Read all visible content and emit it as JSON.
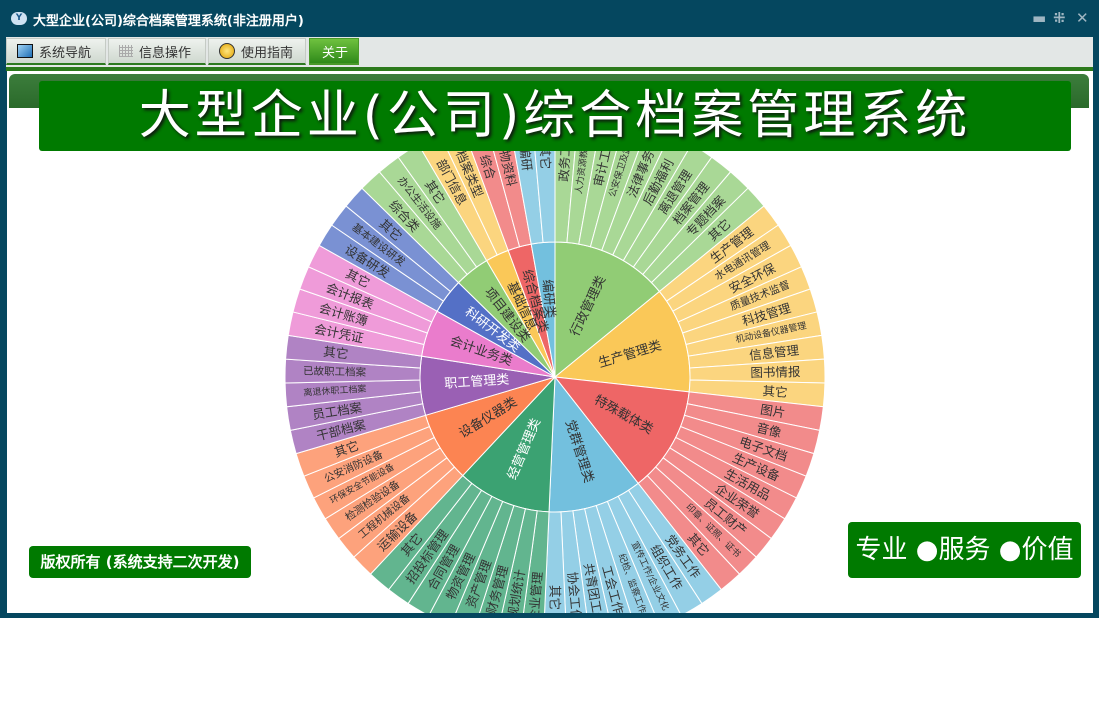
{
  "window": {
    "title": "大型企业(公司)综合档案管理系统(非注册用户)",
    "controls": {
      "minimize": "▬",
      "restore": "⁜",
      "close": "✕"
    }
  },
  "tabs": [
    {
      "label": "系统导航",
      "icon": "monitor-icon"
    },
    {
      "label": "信息操作",
      "icon": "grid-icon"
    },
    {
      "label": "使用指南",
      "icon": "help-icon"
    },
    {
      "label": "关于",
      "active": true
    }
  ],
  "banner": {
    "title": "大型企业(公司)综合档案管理系统"
  },
  "footer": {
    "copyright": "版权所有 (系统支持二次开发)",
    "slogan": "专业 ●服务 ●价值"
  },
  "chart_data": {
    "type": "sunburst",
    "categories": [
      {
        "name": "行政管理类",
        "color": "#91cc75",
        "leafColor": "#a9d896",
        "children": [
          "政务工作",
          "人力资源教育培训",
          "审计工作",
          "公安保卫及武装",
          "法律事务",
          "后勤福利",
          "离退管理",
          "档案管理",
          "专题档案",
          "其它"
        ]
      },
      {
        "name": "生产管理类",
        "color": "#fac858",
        "leafColor": "#fbd57f",
        "children": [
          "生产管理",
          "水电通讯管理",
          "安全环保",
          "质量技术监督",
          "科技管理",
          "机动设备仪器管理",
          "信息管理",
          "图书情报",
          "其它"
        ]
      },
      {
        "name": "特殊载体类",
        "color": "#ee6666",
        "leafColor": "#f28b8b",
        "children": [
          "图片",
          "音像",
          "电子文档",
          "生产设备",
          "生活用品",
          "企业荣誉",
          "员工财产",
          "印章、证照、证书",
          "其它"
        ]
      },
      {
        "name": "党群管理类",
        "color": "#73c0de",
        "leafColor": "#94cfe6",
        "children": [
          "党务工作",
          "组织工作",
          "宣传工作/企业文化",
          "纪检、监察工作",
          "工会工作",
          "共青团工作",
          "协会工作",
          "其它"
        ]
      },
      {
        "name": "经营管理类",
        "color": "#3ba272",
        "leafColor": "#62b58f",
        "children": [
          "企业管理",
          "规划统计",
          "财务管理",
          "资产管理",
          "物资管理",
          "合同管理",
          "招投标管理",
          "其它"
        ]
      },
      {
        "name": "设备仪器类",
        "color": "#fc8452",
        "leafColor": "#fda27c",
        "children": [
          "运输设备",
          "工程机械设备",
          "检测检验设备",
          "环保安全节能设备",
          "公安消防设备",
          "其它"
        ]
      },
      {
        "name": "职工管理类",
        "color": "#9a60b4",
        "leafColor": "#b083c4",
        "children": [
          "干部档案",
          "员工档案",
          "离退休职工档案",
          "已故职工档案",
          "其它"
        ]
      },
      {
        "name": "会计业务类",
        "color": "#ea7ccc",
        "leafColor": "#ef9bd9",
        "children": [
          "会计凭证",
          "会计账簿",
          "会计报表",
          "其它"
        ]
      },
      {
        "name": "科研开发类",
        "color": "#5470c6",
        "leafColor": "#7a91d3",
        "children": [
          "设备研发",
          "基本建设研发",
          "其它"
        ]
      },
      {
        "name": "项目建设类",
        "color": "#91cc75",
        "leafColor": "#a9d896",
        "children": [
          "综合类",
          "办公生活设施",
          "其它"
        ]
      },
      {
        "name": "基础信息",
        "color": "#fac858",
        "leafColor": "#fbd57f",
        "children": [
          "部门信息",
          "档案类型"
        ]
      },
      {
        "name": "综合档案类",
        "color": "#ee6666",
        "leafColor": "#f28b8b",
        "children": [
          "综合",
          "实物资料"
        ]
      },
      {
        "name": "编研类",
        "color": "#73c0de",
        "leafColor": "#94cfe6",
        "children": [
          "编研",
          "其它"
        ]
      }
    ]
  }
}
